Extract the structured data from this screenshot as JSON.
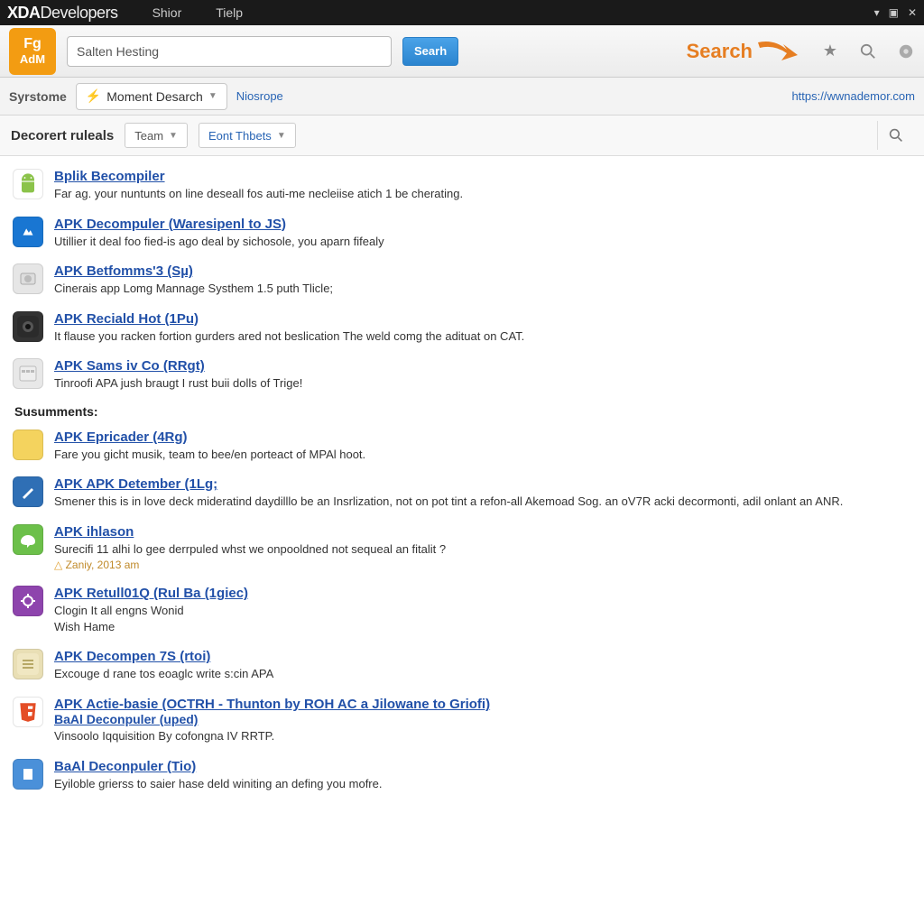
{
  "topbar": {
    "brand_main": "XDA",
    "brand_sub": "Developers",
    "menu": [
      "Shior",
      "Tielp"
    ]
  },
  "header": {
    "logo_line1": "Fg",
    "logo_line2": "AdM",
    "search_value": "Salten Hesting",
    "search_button": "Searh",
    "search_label": "Search"
  },
  "toolbar2": {
    "left_label": "Syrstome",
    "dropdown1": "Moment Desarch",
    "link": "Niosrope",
    "url": "https://wwnademor.com"
  },
  "filter": {
    "label": "Decorert ruleals",
    "dd1": "Team",
    "dd2": "Eont Thbets"
  },
  "results_main": [
    {
      "title": "Bplik Becompiler",
      "desc": "Far ag. your nuntunts on line deseall fos auti-me necleiise atich 1 be cherating.",
      "icon": "android"
    },
    {
      "title": "APK Decompuler (Waresipenl to JS)",
      "desc": "Utillier it deal foo fied-is ago deal by sichosole, you aparn fifealy",
      "icon": "blue"
    },
    {
      "title": "APK Betfomms'3 (Sµ)",
      "desc": "Cinerais app Lomg Mannage Systhem 1.5 puth Tlicle;",
      "icon": "lightgray"
    },
    {
      "title": "APK Reciald Hot (1Pu)",
      "desc": "It flause you racken fortion gurders ared not beslication The weld comg the adituat on CAT.",
      "icon": "dark"
    },
    {
      "title": "APK Sams iv Co (RRgt)",
      "desc": "Tinroofi APA jush braugt I rust buii dolls of Trige!",
      "icon": "cal"
    }
  ],
  "section2_label": "Susumments:",
  "results_secondary": [
    {
      "title": "APK Epricader (4Rg)",
      "desc": "Fare you gicht musik, team to bee/en porteact of MPAl hoot.",
      "icon": "yellow"
    },
    {
      "title": "APK APK Detember (1Lg;",
      "desc": "Smener this is in love deck mideratind daydilllo be an Insrlization, not on pot tint a refon-all Akemoad Sog. an oV7R acki decormonti, adil onlant an ANR.",
      "icon": "bluewrite"
    },
    {
      "title": "APK ihlason",
      "desc": "Surecifi 11 alhi lo gee derrpuled whst we onpooldned not sequeal an fitalit ?",
      "meta": "Zaniy, 2013 am",
      "icon": "green"
    },
    {
      "title": "APK Retull01Q (Rul Ba (1giec)",
      "desc": "Clogin It all engns Wonid\nWish Hame",
      "icon": "purple"
    },
    {
      "title": "APK Decompen 7S (rtoi)",
      "desc": "Excouge d rane tos eoaglc write s:cin APA",
      "icon": "list"
    },
    {
      "title": "APK Actie-basie (OCTRH - Thunton by ROH AC a Jilowane to Griofi)",
      "desc": "",
      "subtitle": "BaAl Deconpuler (uped)",
      "subdesc": "Vinsoolo Iqquisition By cofongna IV RRTP.",
      "icon": "html5"
    },
    {
      "title": "BaAl Deconpuler (Tio)",
      "desc": "Eyiloble grierss to saier hase deld winiting an defing you mofre.",
      "icon": "bluefile"
    }
  ]
}
